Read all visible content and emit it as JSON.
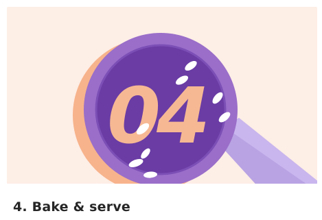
{
  "step": {
    "number_label": "04",
    "caption": "4. Bake & serve",
    "illustration": "magnifying-glass-step-04-illustration"
  },
  "colors": {
    "background": "#fdeee6",
    "lens_outer": "#9a6ec9",
    "lens_inner": "#6a3ca4",
    "numeral": "#f6b893",
    "shadow": "#f7b38c",
    "handle": "#b9a3e3",
    "sesame": "#ffffff",
    "caption_text": "#262626"
  }
}
